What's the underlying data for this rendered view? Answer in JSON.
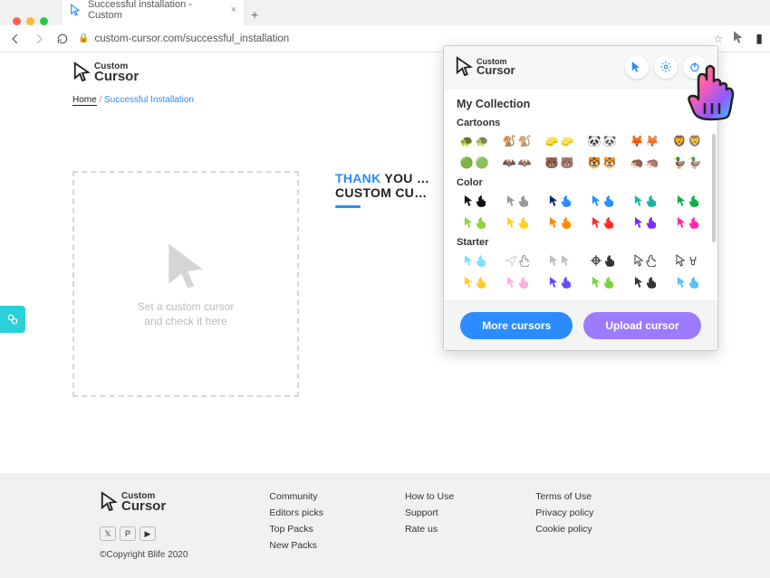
{
  "browser": {
    "tab_title": "Successful installation - Custom",
    "url": "custom-cursor.com/successful_installation"
  },
  "page": {
    "logo_top": "Custom",
    "logo_bottom": "Cursor",
    "breadcrumb_home": "Home",
    "breadcrumb_sep": "/",
    "breadcrumb_current": "Successful Installation",
    "thanks_line1_blue": "THANK",
    "thanks_line1_rest": " YOU …",
    "thanks_line2": "CUSTOM CU…",
    "preview_msg1": "Set a custom cursor",
    "preview_msg2": "and check it here"
  },
  "popup": {
    "collection_title": "My Collection",
    "section_cartoons": "Cartoons",
    "section_color": "Color",
    "section_starter": "Starter",
    "btn_more": "More cursors",
    "btn_upload": "Upload cursor",
    "colors": [
      [
        "#111",
        "#111"
      ],
      [
        "#999",
        "#999"
      ],
      [
        "#0a2b6b",
        "#2a8cff"
      ],
      [
        "#2a8cff",
        "#2a8cff"
      ],
      [
        "#17b6a5",
        "#17b6a5"
      ],
      [
        "#0db04a",
        "#0db04a"
      ],
      [
        "#8fd13f",
        "#8fd13f"
      ],
      [
        "#ffd21e",
        "#ffd21e"
      ],
      [
        "#ff8a00",
        "#ff8a00"
      ],
      [
        "#ff2d2d",
        "#ff2d2d"
      ],
      [
        "#7a2bff",
        "#7a2bff"
      ],
      [
        "#ff2aa7",
        "#ff2aa7"
      ]
    ],
    "cartoons": [
      "🐢",
      "🐒",
      "🧽",
      "🐼",
      "🦊",
      "🦁",
      "🟢",
      "🦇",
      "🐻",
      "🐯",
      "🦔",
      "🦆"
    ],
    "starter": [
      [
        "#7fe1ff",
        "hand"
      ],
      [
        "#cfd3da",
        "plane"
      ],
      [
        "#bdbdbd",
        "classic"
      ],
      [
        "#333",
        "target"
      ],
      [
        "#333",
        "outline"
      ],
      [
        "#333",
        "rock"
      ],
      [
        "#ffcc33",
        "gold"
      ],
      [
        "#ffb0e0",
        "pinkhand"
      ],
      [
        "#6a4bff",
        "violet"
      ],
      [
        "#7ad13f",
        "duo"
      ],
      [
        "#333",
        "mini"
      ],
      [
        "#56c1ff",
        "blue"
      ]
    ]
  },
  "footer": {
    "col1": [
      "Community",
      "Editors picks",
      "Top Packs",
      "New Packs"
    ],
    "col2": [
      "How to Use",
      "Support",
      "Rate us"
    ],
    "col3": [
      "Terms of Use",
      "Privacy policy",
      "Cookie policy"
    ],
    "copyright": "©Copyright Blife 2020"
  }
}
